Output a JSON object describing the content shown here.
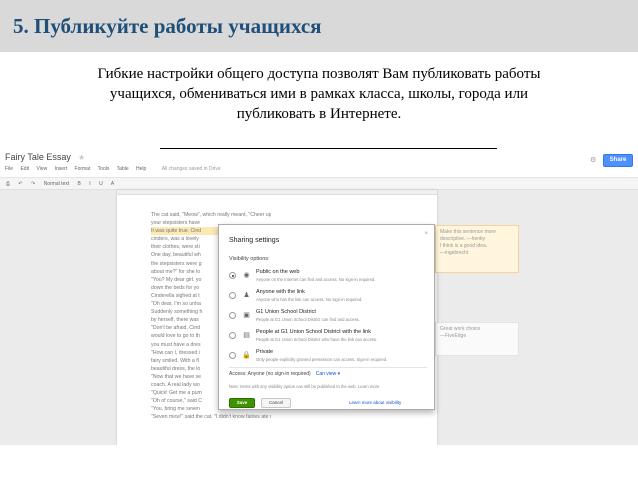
{
  "slide": {
    "title": "5. Публикуйте работы учащихся",
    "subtitle_lines": [
      "Гибкие настройки общего доступа позволят Вам публиковать работы",
      "учащихся, обмениваться ими в рамках класса, школы, города или",
      "публиковать в Интернете."
    ]
  },
  "colors": {
    "title_bar": "#d9d9d9",
    "title_text": "#1f4e79",
    "share_blue": "#4d90fe",
    "save_green": "#3d9400",
    "link_blue": "#1155cc",
    "highlight": "#fce8b2",
    "comment_bg": "#fff6dd"
  },
  "docs": {
    "doc_title": "Fairy Tale Essay",
    "menu": [
      "File",
      "Edit",
      "View",
      "Insert",
      "Format",
      "Tools",
      "Table",
      "Help"
    ],
    "saved_status": "All changes saved in Drive",
    "share_label": "Share",
    "toolbar_font": "Normal text",
    "toolbar_items": [
      "B",
      "I",
      "U",
      "A"
    ],
    "story_lines": [
      "The cat said, \"Meow\", which really meant, \"Cheer up! You have something neither of",
      "your stepsisters have",
      "It was quite true. Cind",
      "cinders, was a lovely",
      "their clothes, were sti",
      "One day, beautiful wh",
      "the stepsisters were g",
      "about me?\" for she lo",
      "\"You? My dear girl, yo",
      "down the beds for yo",
      "",
      "Cinderella sighed at t",
      "\"Oh dear, I'm so unha",
      "Suddenly something h",
      "by herself, there was",
      "\"Don't be afraid, Cind",
      "would love to go to th",
      "you must have a dres",
      "\"How can I, dressed i",
      "fairy smiled. With a fl",
      "beautiful dress, the lo",
      "\"Now that we have se",
      "coach. A real lady wo",
      "\"Quick! Get me a pum",
      "\"Oh of course,\" said C",
      "\"You, bring me seven",
      "\"Seven mice!\" said the cat. \"I didn't know fairies ate mice too!\""
    ],
    "comments": [
      {
        "lines": [
          "Make this sentence more",
          "descriptive. —henky",
          "",
          "I think is a good idea.",
          "—ingebrecht"
        ]
      },
      {
        "lines": [
          "Great work choice",
          "—FiveEdge"
        ]
      }
    ]
  },
  "dialog": {
    "title": "Sharing settings",
    "close_label": "×",
    "visibility_label": "Visibility options:",
    "options": [
      {
        "label": "Public on the web",
        "desc": "Anyone on the Internet can find and access. No sign-in required.",
        "icon": "globe-icon",
        "glyph": "◉",
        "selected": true
      },
      {
        "label": "Anyone with the link",
        "desc": "Anyone who has the link can access. No sign-in required.",
        "icon": "link-person-icon",
        "glyph": "♟",
        "selected": false
      },
      {
        "label": "G1 Union School District",
        "desc": "People at G1 Union School District can find and access.",
        "icon": "building-icon",
        "glyph": "▣",
        "selected": false
      },
      {
        "label": "People at G1 Union School District with the link",
        "desc": "People at G1 Union School District who have the link can access.",
        "icon": "building-link-icon",
        "glyph": "▤",
        "selected": false
      },
      {
        "label": "Private",
        "desc": "Only people explicitly granted permission can access. Sign-in required.",
        "icon": "lock-icon",
        "glyph": "🔒",
        "selected": false
      }
    ],
    "access_text": "Access:  Anyone (no sign-in required)",
    "access_link": "Can view ▾",
    "footnote": "Note: Items with any visibility option can still be published to the web. Learn more",
    "save_label": "Save",
    "cancel_label": "Cancel",
    "learn_more": "Learn more about visibility"
  }
}
